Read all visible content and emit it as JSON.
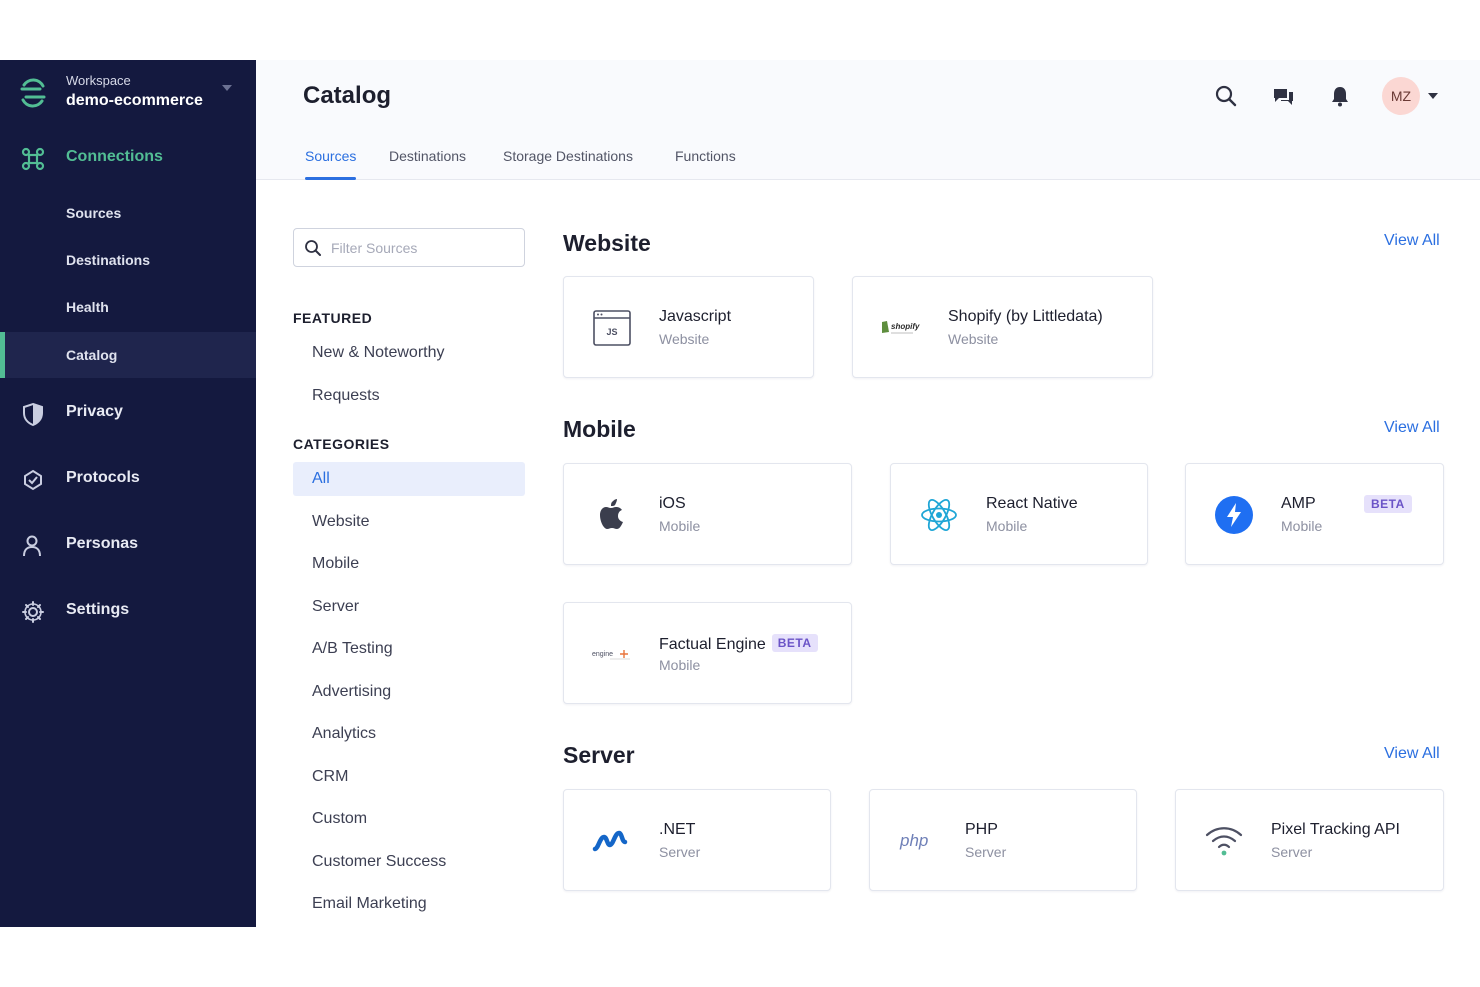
{
  "colors": {
    "sidebar_bg": "#14193f",
    "accent_green": "#52bd94",
    "accent_blue": "#2b6fe0",
    "beta_bg": "#e6e1fb",
    "beta_text": "#6b54c7"
  },
  "workspace": {
    "label": "Workspace",
    "name": "demo-ecommerce",
    "logo_icon": "segment-logo-icon"
  },
  "sidebar": {
    "connections": {
      "label": "Connections",
      "icon": "connections-icon"
    },
    "connections_sub": [
      {
        "label": "Sources"
      },
      {
        "label": "Destinations"
      },
      {
        "label": "Health"
      },
      {
        "label": "Catalog"
      }
    ],
    "privacy": {
      "label": "Privacy",
      "icon": "shield-icon"
    },
    "protocols": {
      "label": "Protocols",
      "icon": "protocols-icon"
    },
    "personas": {
      "label": "Personas",
      "icon": "person-icon"
    },
    "settings": {
      "label": "Settings",
      "icon": "gear-icon"
    }
  },
  "header": {
    "title": "Catalog",
    "avatar_initials": "MZ",
    "tabs": [
      {
        "label": "Sources"
      },
      {
        "label": "Destinations"
      },
      {
        "label": "Storage Destinations"
      },
      {
        "label": "Functions"
      }
    ]
  },
  "filters": {
    "search_placeholder": "Filter Sources",
    "featured_heading": "FEATURED",
    "featured": [
      {
        "label": "New & Noteworthy"
      },
      {
        "label": "Requests"
      }
    ],
    "categories_heading": "CATEGORIES",
    "categories": [
      {
        "label": "All"
      },
      {
        "label": "Website"
      },
      {
        "label": "Mobile"
      },
      {
        "label": "Server"
      },
      {
        "label": "A/B Testing"
      },
      {
        "label": "Advertising"
      },
      {
        "label": "Analytics"
      },
      {
        "label": "CRM"
      },
      {
        "label": "Custom"
      },
      {
        "label": "Customer Success"
      },
      {
        "label": "Email Marketing"
      }
    ]
  },
  "catalog": {
    "view_all": "View All",
    "website": {
      "title": "Website",
      "cards": [
        {
          "name": "Javascript",
          "category": "Website",
          "icon": "javascript-icon",
          "icon_text": "JS"
        },
        {
          "name": "Shopify (by Littledata)",
          "category": "Website",
          "icon": "shopify-logo-icon",
          "icon_text": "shopify"
        }
      ]
    },
    "mobile": {
      "title": "Mobile",
      "cards": [
        {
          "name": "iOS",
          "category": "Mobile",
          "icon": "apple-icon"
        },
        {
          "name": "React Native",
          "category": "Mobile",
          "icon": "react-icon"
        },
        {
          "name": "AMP",
          "category": "Mobile",
          "icon": "amp-icon",
          "badge": "BETA"
        },
        {
          "name": "Factual Engine",
          "category": "Mobile",
          "icon": "factual-engine-logo-icon",
          "icon_text": "engine",
          "badge": "BETA"
        }
      ]
    },
    "server": {
      "title": "Server",
      "cards": [
        {
          "name": ".NET",
          "category": "Server",
          "icon": "dotnet-icon"
        },
        {
          "name": "PHP",
          "category": "Server",
          "icon": "php-icon",
          "icon_text": "php"
        },
        {
          "name": "Pixel Tracking API",
          "category": "Server",
          "icon": "wifi-icon"
        }
      ]
    }
  }
}
